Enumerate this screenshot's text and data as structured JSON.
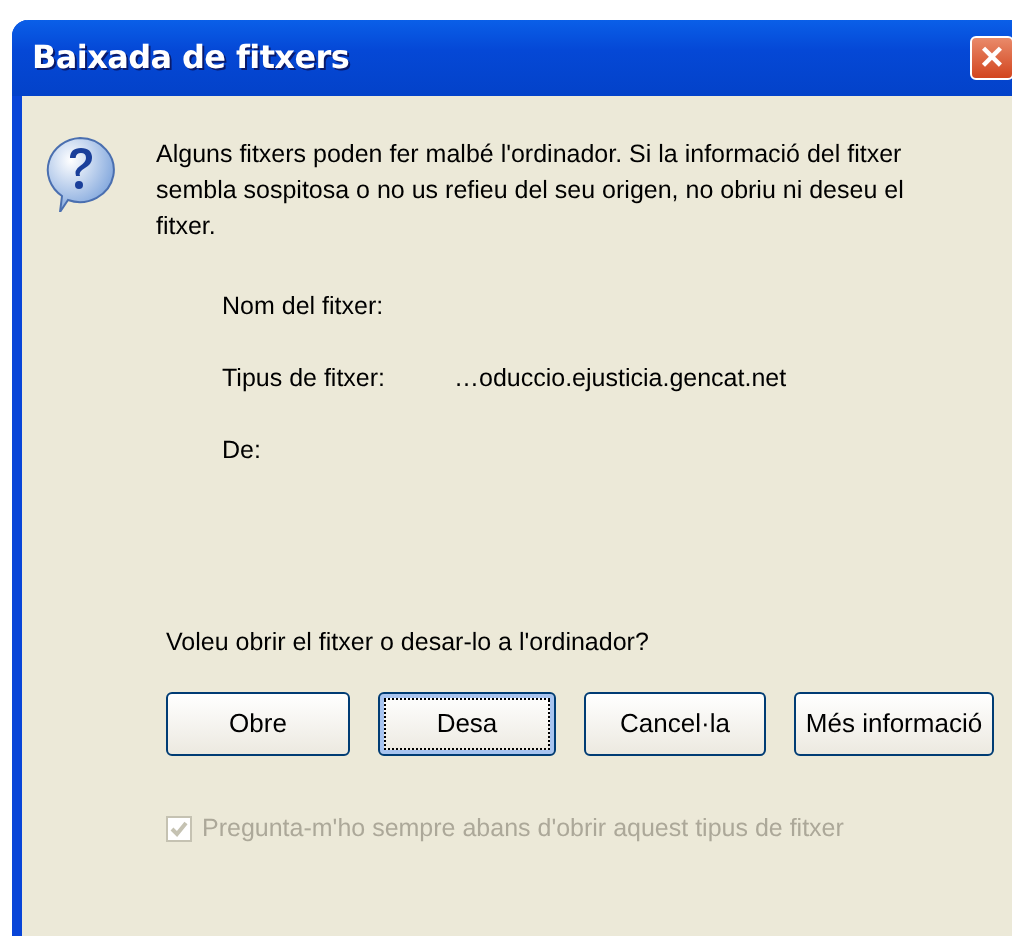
{
  "window": {
    "title": "Baixada de fitxers",
    "close": "×"
  },
  "message": "Alguns fitxers poden  fer malbé l'ordinador. Si la informació del fitxer sembla sospitosa o no us refieu del seu origen, no obriu ni deseu el fitxer.",
  "fields": [
    {
      "label": "Nom del fitxer:"
    },
    {
      "label": "Tipus de fitxer:",
      "value": "…oduccio.ejusticia.gencat.net"
    },
    {
      "label": "De:"
    }
  ],
  "question": "Voleu obrir el fitxer o desar-lo a l'ordinador?",
  "buttons": [
    {
      "label": "Obre",
      "focused": false
    },
    {
      "label": "Desa",
      "focused": true
    },
    {
      "label": "Cancel·la",
      "focused": false
    },
    {
      "label": "Més informació",
      "focused": false
    }
  ],
  "checkbox": {
    "label": "Pregunta-m'ho sempre abans d'obrir aquest tipus de fitxer",
    "checked": true,
    "disabled": true
  }
}
